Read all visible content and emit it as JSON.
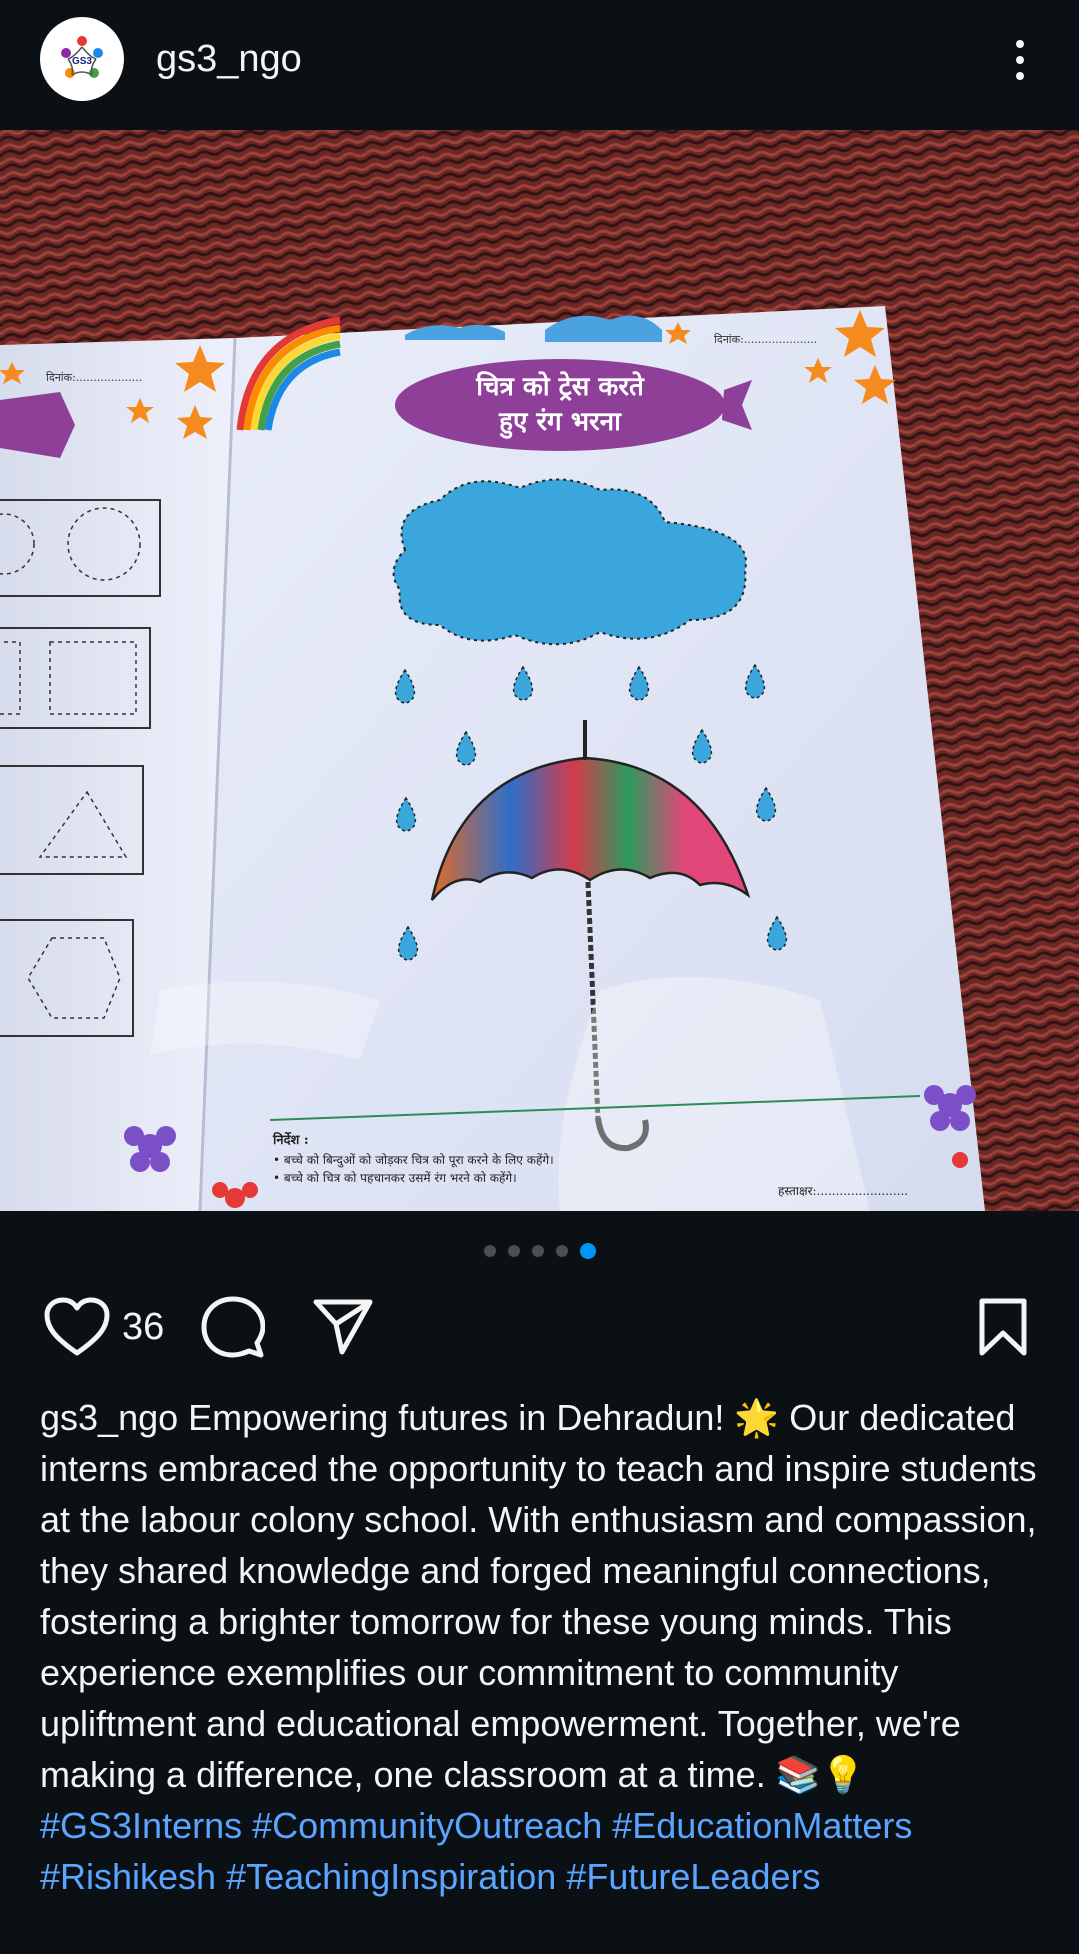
{
  "header": {
    "username": "gs3_ngo",
    "avatar_text": "GS3",
    "menu_icon": "more-vertical-icon"
  },
  "post": {
    "image_description": "workbook-page-trace-and-color",
    "image_text": {
      "title_line1": "चित्र को ट्रेस करते",
      "title_line2": "हुए रंग भरना",
      "date_label": "दिनांक:.....................",
      "left_date_label": "दिनांक:...................",
      "instructions_heading": "निर्देश :",
      "instruction_1": "• बच्चे को बिन्दुओं को जोड़कर चित्र को पूरा करने के लिए कहेंगे।",
      "instruction_2": "• बच्चे को चित्र को पहचानकर उसमें रंग भरने को कहेंगे।",
      "signature_label": "हस्ताक्षर:........................"
    },
    "carousel": {
      "count": 5,
      "active_index": 4
    }
  },
  "actions": {
    "like_icon": "heart-icon",
    "like_count": "36",
    "comment_icon": "comment-icon",
    "share_icon": "send-icon",
    "save_icon": "bookmark-icon"
  },
  "caption": {
    "username": "gs3_ngo",
    "text": " Empowering futures in Dehradun! 🌟 Our dedicated interns embraced the opportunity to teach and inspire students at the labour colony school. With enthusiasm and compassion, they shared knowledge and forged meaningful connections, fostering a brighter tomorrow for these young minds. This experience exemplifies our commitment to community upliftment and educational empowerment. Together, we're making a difference, one classroom at a time. 📚💡",
    "hashtags": "#GS3Interns #CommunityOutreach #EducationMatters #Rishikesh #TeachingInspiration #FutureLeaders"
  },
  "colors": {
    "background": "#0b1014",
    "text": "#f5f5f5",
    "hashtag": "#5ba4ff",
    "accent": "#0095f6"
  }
}
